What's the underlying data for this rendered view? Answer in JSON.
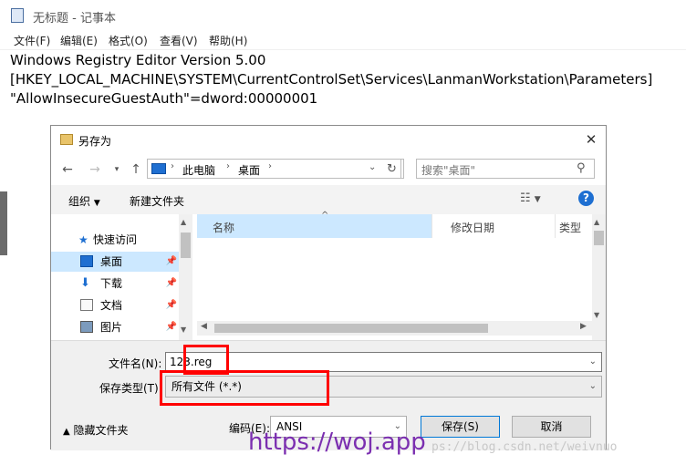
{
  "notepad": {
    "title": "无标题 - 记事本",
    "menu": [
      "文件(F)",
      "编辑(E)",
      "格式(O)",
      "查看(V)",
      "帮助(H)"
    ],
    "content_lines": [
      "Windows Registry Editor Version 5.00",
      "[HKEY_LOCAL_MACHINE\\SYSTEM\\CurrentControlSet\\Services\\LanmanWorkstation\\Parameters]",
      "\"AllowInsecureGuestAuth\"=dword:00000001"
    ]
  },
  "dialog": {
    "title": "另存为",
    "close": "✕",
    "breadcrumb": [
      "此电脑",
      "桌面"
    ],
    "search_placeholder": "搜索\"桌面\"",
    "toolbar": {
      "organize": "组织",
      "new_folder": "新建文件夹"
    },
    "nav_items": [
      {
        "label": "快速访问",
        "icon": "star-icon"
      },
      {
        "label": "桌面",
        "icon": "desktop-icon",
        "selected": true
      },
      {
        "label": "下载",
        "icon": "download-icon"
      },
      {
        "label": "文档",
        "icon": "document-icon"
      },
      {
        "label": "图片",
        "icon": "picture-icon"
      }
    ],
    "columns": [
      "名称",
      "修改日期",
      "类型"
    ],
    "filename_label": "文件名(N):",
    "filename_value": "123.reg",
    "filetype_label": "保存类型(T):",
    "filetype_value": "所有文件  (*.*)",
    "hide_folders": "隐藏文件夹",
    "encoding_label": "编码(E):",
    "encoding_value": "ANSI",
    "save_button": "保存(S)",
    "cancel_button": "取消"
  },
  "watermarks": {
    "primary": "https://woj.app",
    "secondary": "ps://blog.csdn.net/weivnuo"
  },
  "colors": {
    "highlight": "#ff0000",
    "selection": "#cce8ff",
    "watermark": "#7b2fb0"
  }
}
